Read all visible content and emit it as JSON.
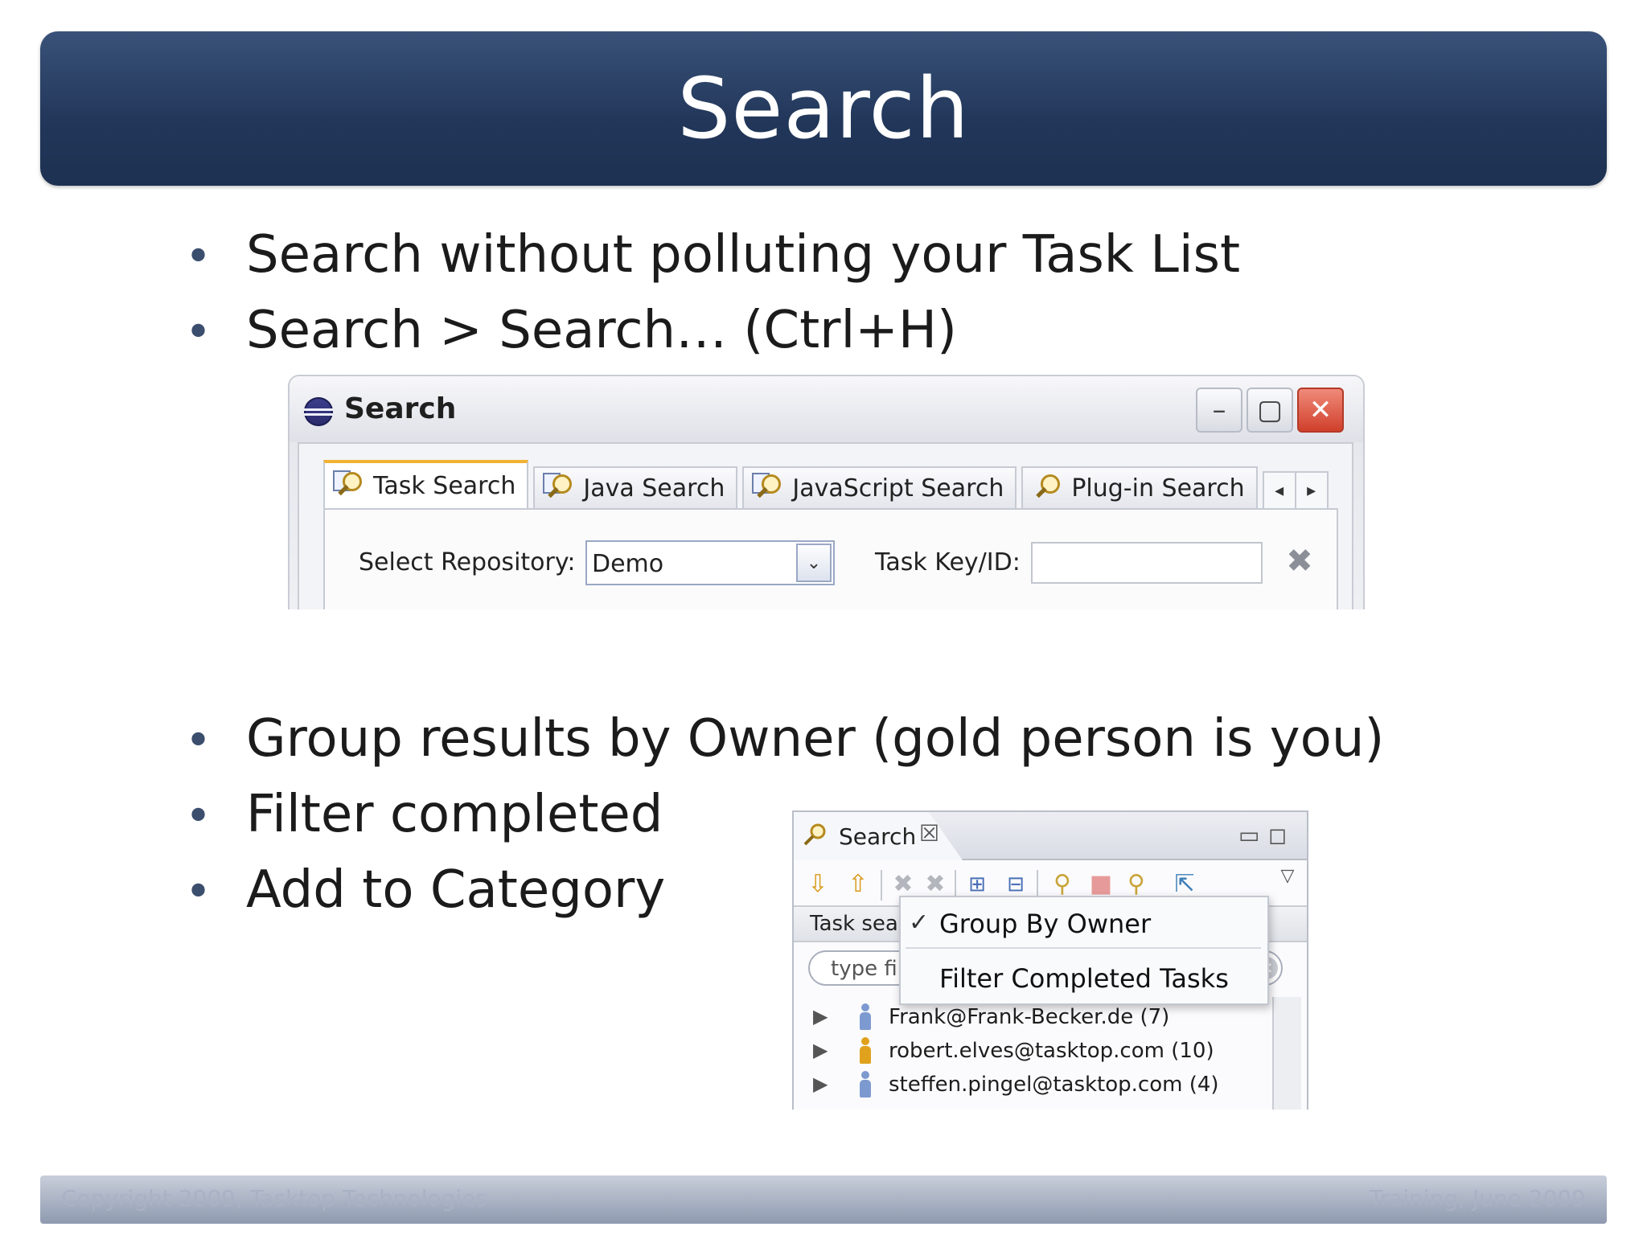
{
  "slide": {
    "title": "Search",
    "bullets_top": [
      "Search without polluting your Task List",
      "Search > Search… (Ctrl+H)"
    ],
    "bullets_bottom": [
      "Group results by Owner (gold person is you)",
      "Filter completed",
      "Add to Category"
    ],
    "bullet_symbol": "•"
  },
  "search_dialog": {
    "title": "Search",
    "window_buttons": {
      "minimize": "–",
      "maximize": "▢",
      "close": "✕"
    },
    "tabs": [
      {
        "label": "Task Search",
        "icon": "task-search-icon",
        "active": true
      },
      {
        "label": "Java Search",
        "icon": "java-search-icon",
        "active": false
      },
      {
        "label": "JavaScript Search",
        "icon": "javascript-search-icon",
        "active": false
      },
      {
        "label": "Plug-in Search",
        "icon": "plugin-search-icon",
        "active": false
      }
    ],
    "tab_scroll": {
      "left": "◂",
      "right": "▸"
    },
    "select_repository_label": "Select Repository:",
    "repository_value": "Demo",
    "task_key_label": "Task Key/ID:",
    "task_key_value": "",
    "clear_icon": "✖"
  },
  "search_view": {
    "tab_label": "Search",
    "tab_close": "☒",
    "view_controls": {
      "minimize": "▭",
      "maximize": "◻"
    },
    "toolbar_icons": [
      "down-arrow-icon",
      "up-arrow-icon",
      "remove-icon",
      "remove-all-icon",
      "expand-all-icon",
      "collapse-all-icon",
      "search-again-icon",
      "stop-icon",
      "history-icon",
      "pin-icon",
      "view-menu-icon"
    ],
    "header_text": "Task sea",
    "filter_text": "type fil",
    "context_menu": [
      {
        "label": "Group By Owner",
        "checked": true
      },
      {
        "label": "Filter Completed Tasks",
        "checked": false
      }
    ],
    "results": [
      {
        "owner": "Frank@Frank-Becker.de (7)",
        "is_you": false
      },
      {
        "owner": "robert.elves@tasktop.com (10)",
        "is_you": true
      },
      {
        "owner": "steffen.pingel@tasktop.com (4)",
        "is_you": false
      }
    ],
    "colors": {
      "person_you": "#e0a21d",
      "person_other": "#7d9ad0"
    }
  },
  "footer": {
    "left": "Copyright 2009, Tasktop Technologies",
    "right": "Training, June 2009"
  }
}
